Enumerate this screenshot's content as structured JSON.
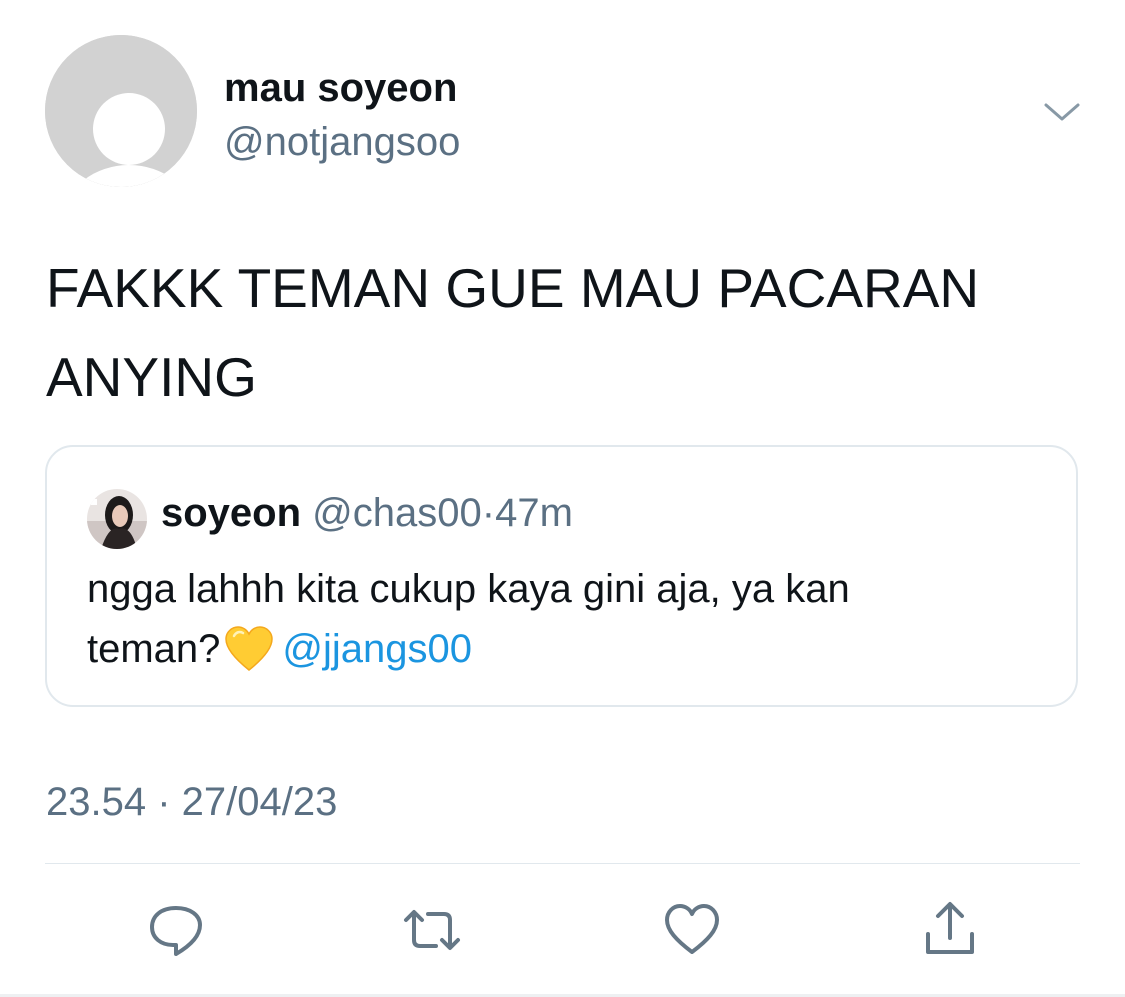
{
  "tweet": {
    "author": {
      "display_name": "mau soyeon",
      "handle": "@notjangsoo"
    },
    "text_line1": "FAKKK TEMAN GUE MAU PACARAN",
    "text_line2": "ANYING",
    "timestamp": "23.54 · 27/04/23"
  },
  "quoted_tweet": {
    "author": {
      "display_name": "soyeon",
      "handle": "@chas00",
      "separator": "·",
      "age": "47m"
    },
    "text_line1": "ngga lahhh kita cukup kaya gini aja, ya kan",
    "text_line2": "teman?",
    "emoji": "yellow-heart",
    "mention": "@jjangs00"
  },
  "actions": {
    "icons": [
      "reply-icon",
      "retweet-icon",
      "like-icon",
      "share-icon"
    ]
  },
  "colors": {
    "text_primary": "#0f1419",
    "text_secondary": "#5b7083",
    "link": "#1b95e0",
    "border": "#e1e8ed",
    "heart_emoji": "#ffcc33"
  }
}
